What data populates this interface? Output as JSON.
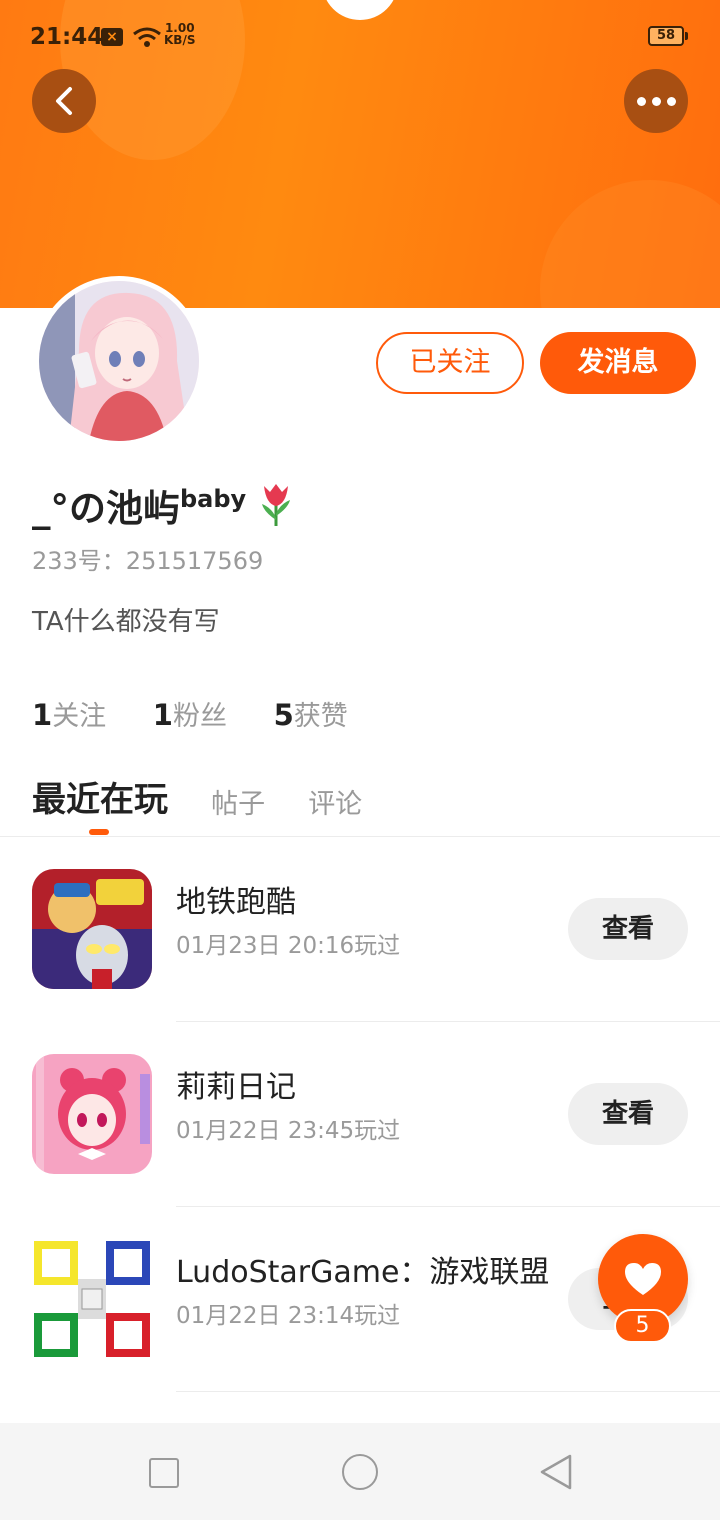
{
  "status_bar": {
    "time": "21:44",
    "speed_value": "1.00",
    "speed_unit": "KB/S",
    "battery": "58"
  },
  "header": {
    "back_icon": "chevron-left-icon",
    "more_icon": "more-dots-icon"
  },
  "profile": {
    "follow_label": "已关注",
    "message_label": "发消息",
    "username_main": "_°の池屿",
    "username_sup": "baby",
    "username_emoji": "tulip-icon",
    "user_id": "233号：251517569",
    "bio": "TA什么都没有写",
    "stats": [
      {
        "count": "1",
        "label": "关注"
      },
      {
        "count": "1",
        "label": "粉丝"
      },
      {
        "count": "5",
        "label": "获赞"
      }
    ]
  },
  "tabs": [
    {
      "label": "最近在玩",
      "active": true
    },
    {
      "label": "帖子",
      "active": false
    },
    {
      "label": "评论",
      "active": false
    }
  ],
  "games": [
    {
      "name": "地铁跑酷",
      "time": "01月23日 20:16玩过",
      "button": "查看"
    },
    {
      "name": "莉莉日记",
      "time": "01月22日 23:45玩过",
      "button": "查看"
    },
    {
      "name": "LudoStarGame：游戏联盟",
      "time": "01月22日 23:14玩过",
      "button": "查看"
    }
  ],
  "like_fab": {
    "count": "5"
  },
  "colors": {
    "accent": "#ff5a0a",
    "header": "#ff8a10"
  }
}
